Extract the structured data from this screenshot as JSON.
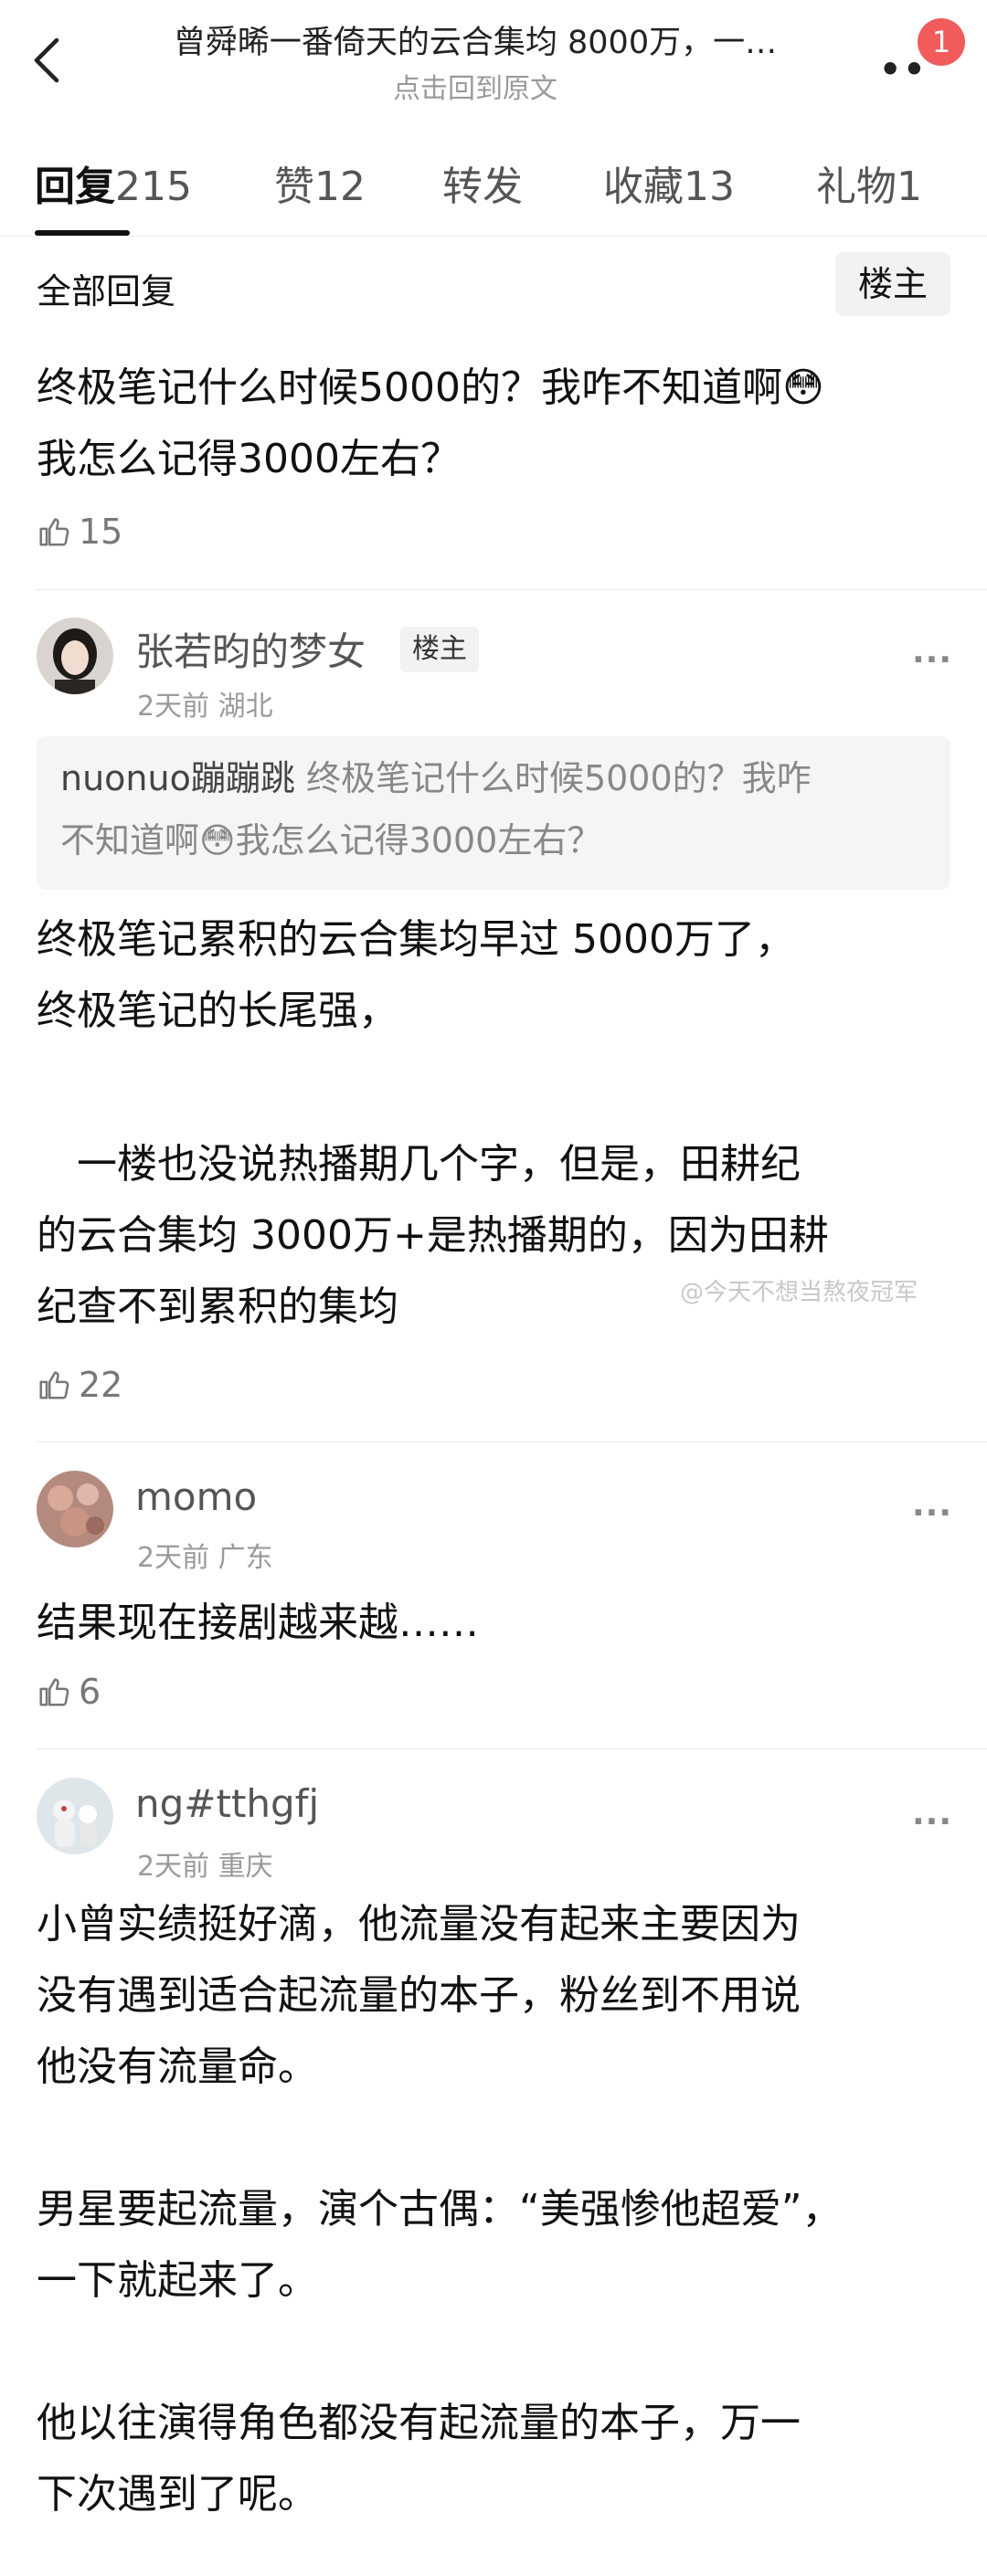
{
  "header": {
    "title": "曾舜晞一番倚天的云合集均 8000万，一…",
    "subtitle": "点击回到原文",
    "badge": "1"
  },
  "tabs": [
    {
      "label": "回复",
      "count": "215"
    },
    {
      "label": "赞",
      "count": "12"
    },
    {
      "label": "转发",
      "count": ""
    },
    {
      "label": "收藏",
      "count": "13"
    },
    {
      "label": "礼物",
      "count": "1"
    }
  ],
  "filter": {
    "all_replies": "全部回复",
    "owner_only": "楼主"
  },
  "main_post": {
    "lines": [
      "终极笔记什么时候5000的？我咋不知道啊😳",
      "我怎么记得3000左右？"
    ],
    "likes": "15"
  },
  "comments": [
    {
      "user": "张若昀的梦女",
      "tag": "楼主",
      "meta": "2天前 湖北",
      "quote_user": "nuonuo蹦蹦跳",
      "quote_lines": [
        "终极笔记什么时候5000的？我咋",
        "不知道啊😳我怎么记得3000左右？"
      ],
      "lines": [
        " 终极笔记累积的云合集均早过 5000万了，",
        "终极笔记的长尾强，",
        "",
        "　一楼也没说热播期几个字，但是，田耕纪",
        "的云合集均 3000万+是热播期的，因为田耕",
        "纪查不到累积的集均"
      ],
      "likes": "22"
    },
    {
      "user": "momo",
      "meta": "2天前 广东",
      "lines": [
        "结果现在接剧越来越……"
      ],
      "likes": "6"
    },
    {
      "user": "ng#tthgfj",
      "meta": "2天前 重庆",
      "lines": [
        "小曾实绩挺好滴，他流量没有起来主要因为",
        "没有遇到适合起流量的本子，粉丝到不用说",
        "他没有流量命。",
        "",
        "男星要起流量，演个古偶：“美强惨他超爱”，",
        "一下就起来了。",
        "",
        "他以往演得角色都没有起流量的本子，万一",
        "下次遇到了呢。"
      ]
    }
  ],
  "watermark": "@今天不想当熬夜冠军",
  "colors": {
    "badge": "#f25b5b",
    "muted": "#9a9a9a",
    "quote_bg": "#f5f5f5"
  }
}
